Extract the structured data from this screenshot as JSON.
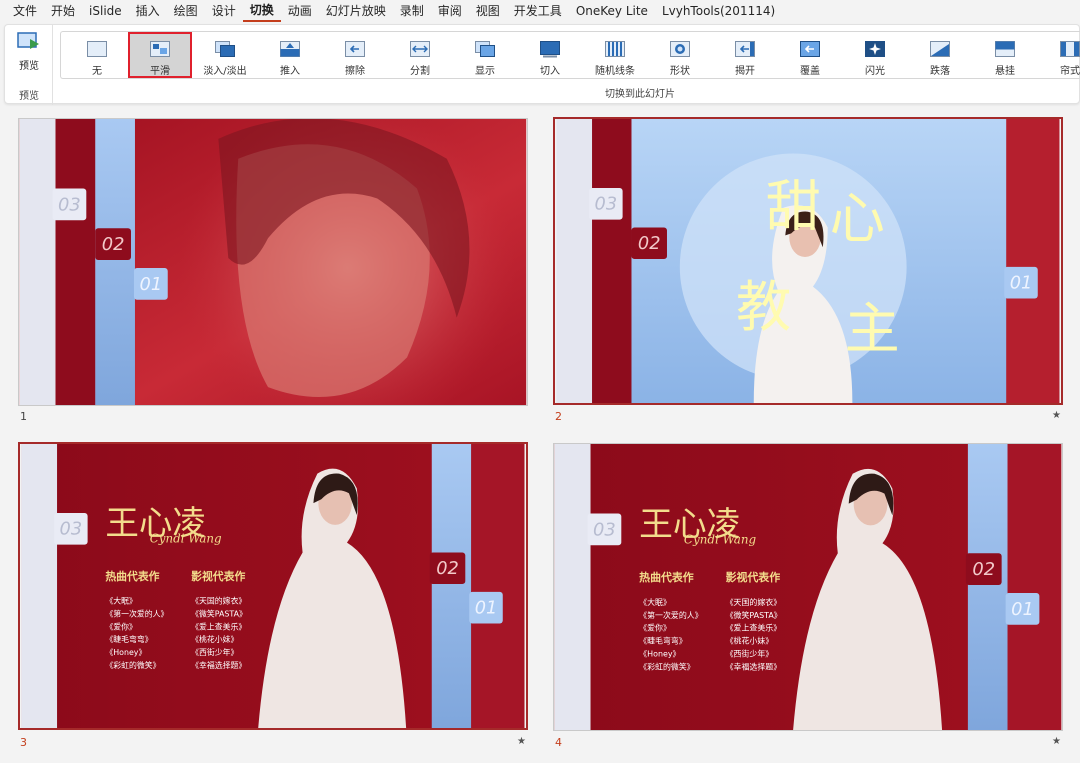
{
  "menu": {
    "items": [
      "文件",
      "开始",
      "iSlide",
      "插入",
      "绘图",
      "设计",
      "切换",
      "动画",
      "幻灯片放映",
      "录制",
      "审阅",
      "视图",
      "开发工具",
      "OneKey Lite",
      "LvyhTools(201114)"
    ],
    "active": "切换"
  },
  "ribbon": {
    "preview_label": "预览",
    "preview_group_label": "预览",
    "transition_group_label": "切换到此幻灯片",
    "effects": [
      {
        "label": "无",
        "icon": "none-icon"
      },
      {
        "label": "平滑",
        "icon": "morph-icon",
        "selected": true
      },
      {
        "label": "淡入/淡出",
        "icon": "fade-icon"
      },
      {
        "label": "推入",
        "icon": "push-icon"
      },
      {
        "label": "擦除",
        "icon": "wipe-icon"
      },
      {
        "label": "分割",
        "icon": "split-icon"
      },
      {
        "label": "显示",
        "icon": "reveal-icon"
      },
      {
        "label": "切入",
        "icon": "cut-icon"
      },
      {
        "label": "随机线条",
        "icon": "random-bars-icon"
      },
      {
        "label": "形状",
        "icon": "shape-icon"
      },
      {
        "label": "揭开",
        "icon": "uncover-icon"
      },
      {
        "label": "覆盖",
        "icon": "cover-icon"
      },
      {
        "label": "闪光",
        "icon": "flash-icon"
      },
      {
        "label": "跌落",
        "icon": "fall-over-icon"
      },
      {
        "label": "悬挂",
        "icon": "drape-icon"
      },
      {
        "label": "帘式",
        "icon": "curtains-icon"
      }
    ],
    "highlight_color": "#e0202c"
  },
  "slides": [
    {
      "number": "1",
      "tags": [
        "03",
        "02",
        "01"
      ],
      "has_star": false
    },
    {
      "number": "2",
      "tags": [
        "03",
        "02",
        "01"
      ],
      "title_chars": [
        "甜",
        "心",
        "教",
        "主"
      ],
      "has_star": true
    },
    {
      "number": "3",
      "tags": [
        "03",
        "02",
        "01"
      ],
      "has_star": true,
      "name": "王心凌",
      "signature": "Cyndi Wang",
      "songs_header": "热曲代表作",
      "films_header": "影视代表作",
      "songs": [
        "《大眠》",
        "《第一次爱的人》",
        "《爱你》",
        "《睫毛弯弯》",
        "《Honey》",
        "《彩虹的微笑》"
      ],
      "films": [
        "《天国的嫁衣》",
        "《微笑PASTA》",
        "《爱上查美乐》",
        "《桃花小妹》",
        "《西街少年》",
        "《幸福选择题》"
      ]
    },
    {
      "number": "4",
      "tags": [
        "03",
        "02",
        "01"
      ],
      "has_star": true,
      "name": "王心凌",
      "signature": "Cyndi Wang",
      "songs_header": "热曲代表作",
      "films_header": "影视代表作",
      "songs": [
        "《大眠》",
        "《第一次爱的人》",
        "《爱你》",
        "《睫毛弯弯》",
        "《Honey》",
        "《彩虹的微笑》"
      ],
      "films": [
        "《天国的嫁衣》",
        "《微笑PASTA》",
        "《爱上查美乐》",
        "《桃花小妹》",
        "《西街少年》",
        "《幸福选择题》"
      ]
    }
  ],
  "colors": {
    "accent": "#c43e1c",
    "deep_red": "#8b0a1a",
    "blue": "#9cc1f0",
    "gold": "#f3dc8c",
    "cream": "#fffbb0"
  }
}
